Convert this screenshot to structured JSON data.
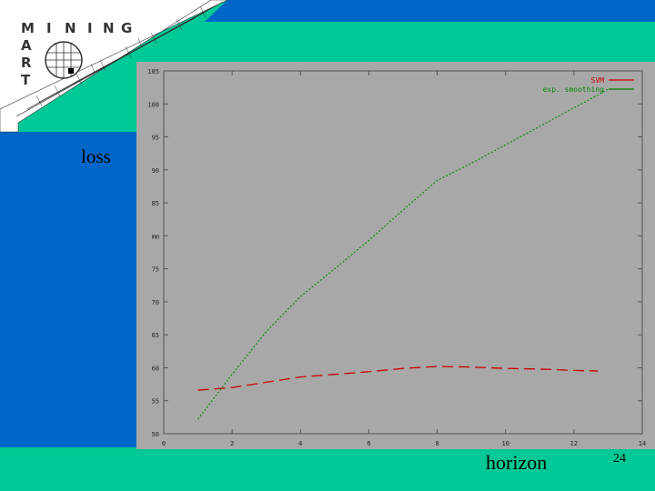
{
  "logo": {
    "letters_row1": [
      "M",
      "I",
      "N",
      "I",
      "N",
      "G"
    ],
    "letters_col": [
      "A",
      "R",
      "T"
    ]
  },
  "slide": {
    "y_axis_label": "loss",
    "x_axis_label": "horizon",
    "page_number": "24"
  },
  "colors": {
    "background": "#00c896",
    "blue_panel": "#0066c8",
    "plot_background": "#a8a8a8",
    "svm_line": "#cc0000",
    "exp_line": "#008800"
  },
  "chart_data": {
    "type": "line",
    "xlim": [
      0,
      14
    ],
    "ylim": [
      50,
      105
    ],
    "x_ticks": [
      "0",
      "2",
      "4",
      "6",
      "8",
      "10",
      "12",
      "14"
    ],
    "y_ticks": [
      "50",
      "55",
      "60",
      "65",
      "70",
      "75",
      "mm",
      "85",
      "90",
      "95",
      "100",
      "105"
    ],
    "legend_position": "top-right",
    "series": [
      {
        "name": "SVM",
        "x": [
          1,
          2,
          3,
          4,
          5,
          6,
          7,
          8,
          9,
          10,
          11,
          12,
          12.7
        ],
        "values": [
          56.6,
          57.0,
          57.8,
          58.6,
          59.0,
          59.4,
          59.9,
          60.2,
          60.1,
          59.9,
          59.8,
          59.6,
          59.5
        ]
      },
      {
        "name": "exp. smoothing",
        "x": [
          1,
          2,
          3,
          4,
          5,
          6,
          7,
          8,
          9,
          10,
          11,
          12,
          13
        ],
        "values": [
          52.2,
          59.0,
          65.5,
          70.8,
          75.0,
          79.3,
          83.9,
          88.4,
          91.0,
          93.8,
          96.6,
          99.4,
          102.2
        ]
      }
    ]
  }
}
